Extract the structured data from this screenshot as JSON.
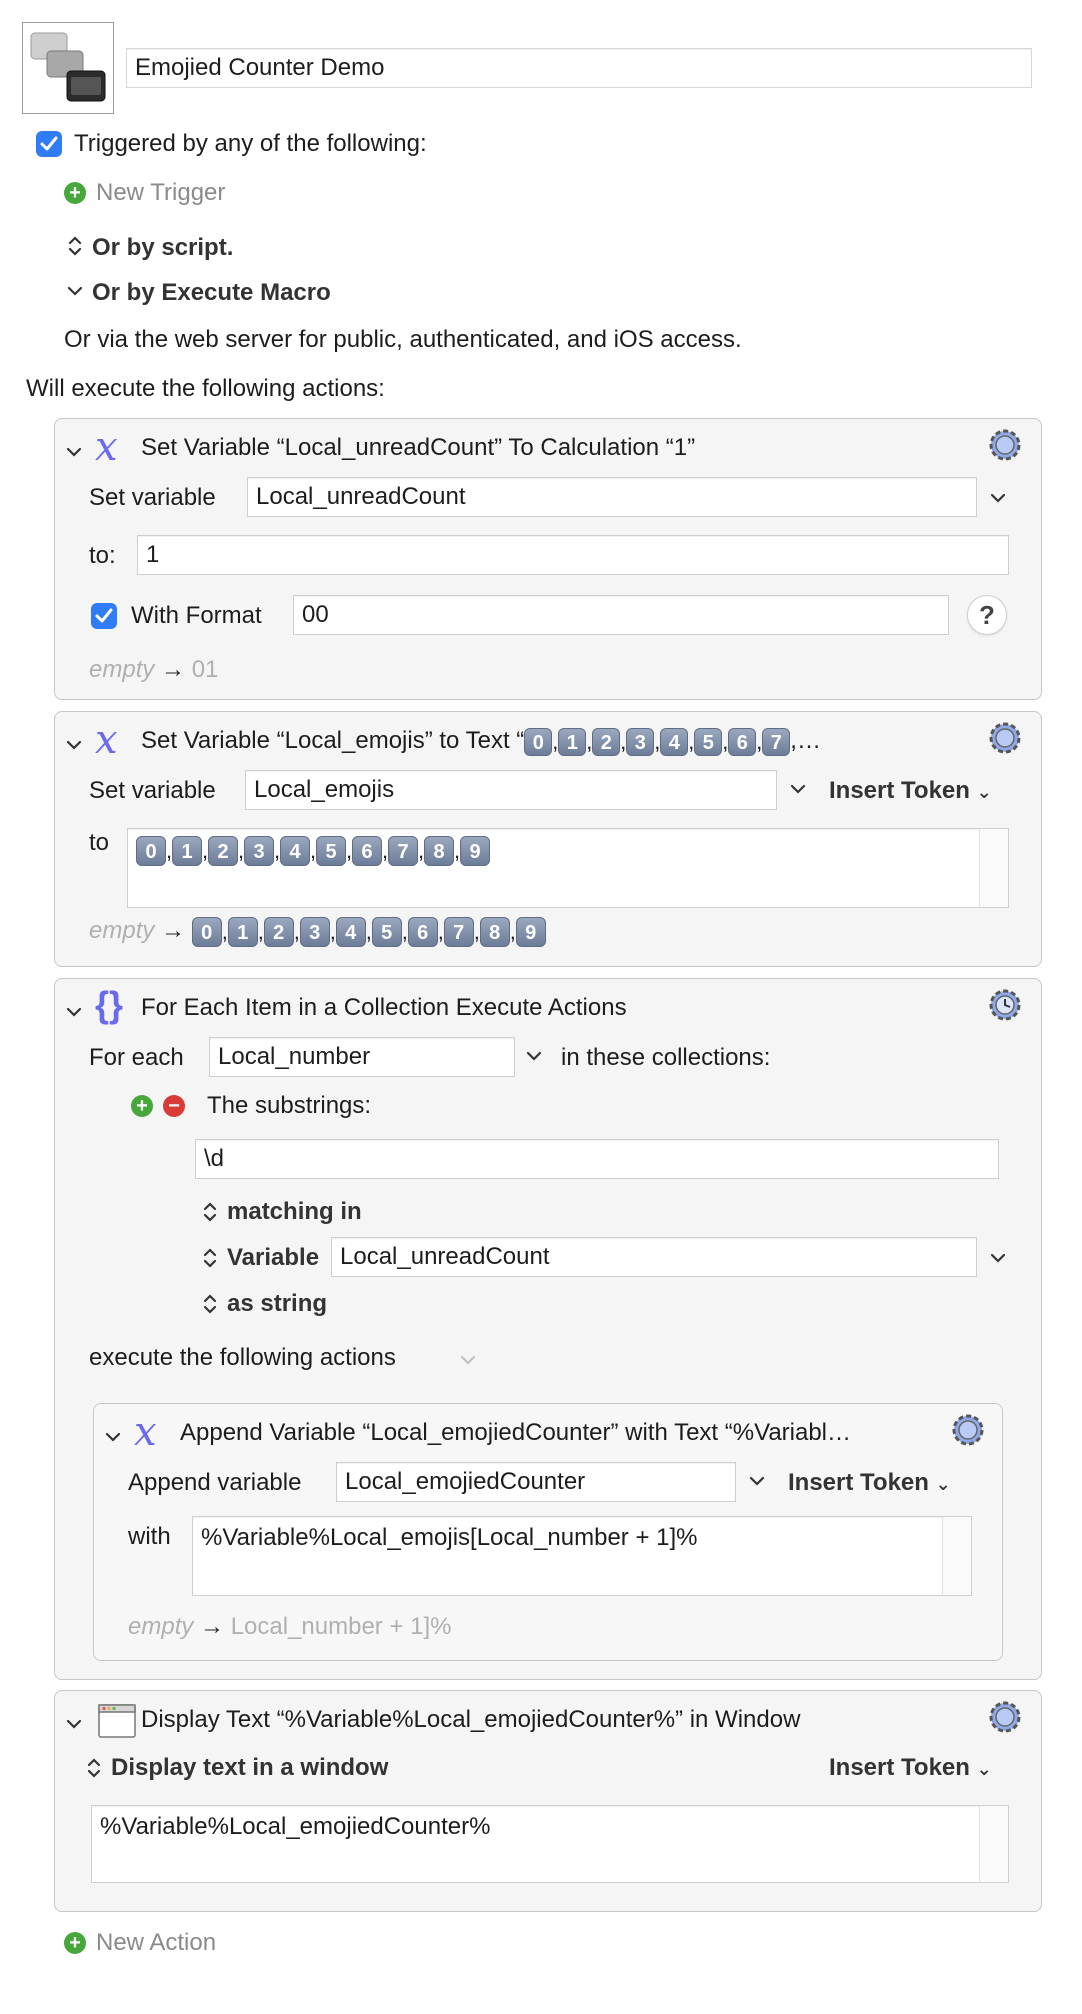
{
  "macro": {
    "name": "Emojied Counter Demo",
    "triggered_label": "Triggered by any of the following:",
    "new_trigger": "New Trigger",
    "or_by_script": "Or by script.",
    "or_by_execute_macro": "Or by Execute Macro",
    "web_server_text": "Or via the web server for public, authenticated, and iOS access.",
    "will_execute": "Will execute the following actions:",
    "new_action": "New Action"
  },
  "action1": {
    "title": "Set Variable “Local_unreadCount” To Calculation “1”",
    "set_variable_label": "Set variable",
    "variable_value": "Local_unreadCount",
    "to_label": "to:",
    "to_value": "1",
    "with_format_label": "With Format",
    "format_value": "00",
    "help": "?",
    "preview_empty": "empty",
    "preview_arrow": "→",
    "preview_value": "01"
  },
  "action2": {
    "title_prefix": "Set Variable “Local_emojis” to Text “",
    "title_suffix": ",…",
    "set_variable_label": "Set variable",
    "variable_value": "Local_emojis",
    "insert_token": "Insert Token",
    "to_label": "to",
    "digits": [
      "0",
      "1",
      "2",
      "3",
      "4",
      "5",
      "6",
      "7",
      "8",
      "9"
    ],
    "preview_empty": "empty",
    "preview_arrow": "→"
  },
  "action3": {
    "title": "For Each Item in a Collection Execute Actions",
    "for_each_label": "For each",
    "variable_value": "Local_number",
    "in_collections_label": "in these collections:",
    "substrings_label": "The substrings:",
    "regex_value": "\\d",
    "matching_in": "matching in",
    "variable_label": "Variable",
    "source_variable": "Local_unreadCount",
    "as_string": "as string",
    "execute_label": "execute the following actions"
  },
  "action3_inner": {
    "title": "Append Variable “Local_emojiedCounter” with Text “%Variabl…",
    "append_label": "Append variable",
    "variable_value": "Local_emojiedCounter",
    "insert_token": "Insert Token",
    "with_label": "with",
    "with_value": "%Variable%Local_emojis[Local_number + 1]%",
    "preview_empty": "empty",
    "preview_arrow": "→",
    "preview_value": "Local_number + 1]%"
  },
  "action4": {
    "title": "Display Text “%Variable%Local_emojiedCounter%” in Window",
    "mode_label": "Display text in a window",
    "insert_token": "Insert Token",
    "text_value": "%Variable%Local_emojiedCounter%"
  },
  "colors": {
    "accent_blue": "#2f7cf6",
    "add_green": "#46a83a",
    "remove_red": "#d83a36",
    "x_icon_purple": "#6a6af0"
  }
}
